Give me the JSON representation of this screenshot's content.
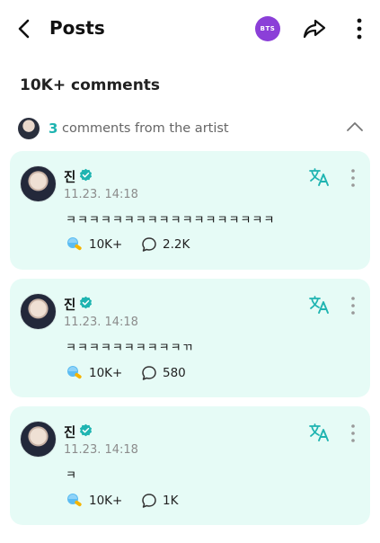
{
  "header": {
    "title": "Posts",
    "group_badge": "BTS"
  },
  "comments_count_label": "10K+ comments",
  "artist_comments": {
    "count": "3",
    "label": "comments from the artist"
  },
  "comments": [
    {
      "name": "진",
      "time": "11.23. 14:18",
      "text": "ㅋㅋㅋㅋㅋㅋㅋㅋㅋㅋㅋㅋㅋㅋㅋㅋㅋㅋ",
      "likes": "10K+",
      "replies": "2.2K"
    },
    {
      "name": "진",
      "time": "11.23. 14:18",
      "text": "ㅋㅋㅋㅋㅋㅋㅋㅋㅋㅋㄲ",
      "likes": "10K+",
      "replies": "580"
    },
    {
      "name": "진",
      "time": "11.23. 14:18",
      "text": "ㅋ",
      "likes": "10K+",
      "replies": "1K"
    }
  ],
  "icons": {
    "back": "chevron-left-icon",
    "share": "share-arrow-icon",
    "more": "more-vertical-icon",
    "collapse": "chevron-up-icon",
    "translate": "translate-icon",
    "verified": "verified-badge-icon",
    "like": "lightstick-like-icon",
    "reply": "speech-bubble-icon"
  },
  "colors": {
    "accent": "#1fb4b1",
    "card_background": "#e6fbf6",
    "group_badge": "#8b3fd8"
  }
}
